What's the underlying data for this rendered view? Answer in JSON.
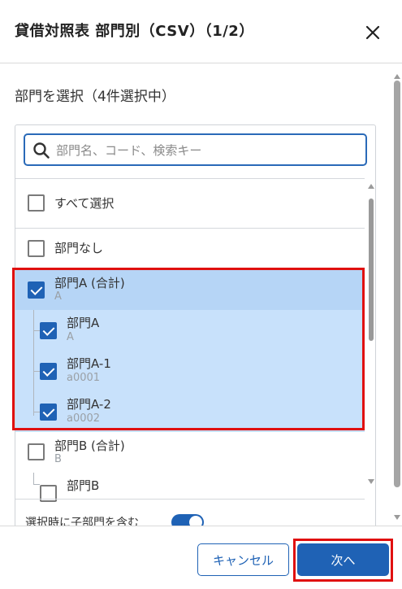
{
  "dialog": {
    "title": "貸借対照表 部門別（CSV）（1/2）",
    "close_icon": "close-icon"
  },
  "section": {
    "label": "部門を選択（4件選択中）"
  },
  "search": {
    "placeholder": "部門名、コード、検索キー",
    "value": "",
    "icon": "search-icon"
  },
  "items": [
    {
      "label": "すべて選択",
      "code": "",
      "checked": false
    },
    {
      "label": "部門なし",
      "code": "",
      "checked": false
    },
    {
      "label": "部門A (合計)",
      "code": "A",
      "checked": true
    },
    {
      "label": "部門A",
      "code": "A",
      "checked": true
    },
    {
      "label": "部門A-1",
      "code": "a0001",
      "checked": true
    },
    {
      "label": "部門A-2",
      "code": "a0002",
      "checked": true
    },
    {
      "label": "部門B (合計)",
      "code": "B",
      "checked": false
    },
    {
      "label": "部門B",
      "code": "",
      "checked": false
    }
  ],
  "toggle": {
    "label": "選択時に子部門を含む",
    "on": true
  },
  "footer": {
    "cancel_label": "キャンセル",
    "next_label": "次へ"
  },
  "colors": {
    "accent": "#1f62b5",
    "selected_row": "#c8e1fb",
    "highlight": "#e01010"
  }
}
